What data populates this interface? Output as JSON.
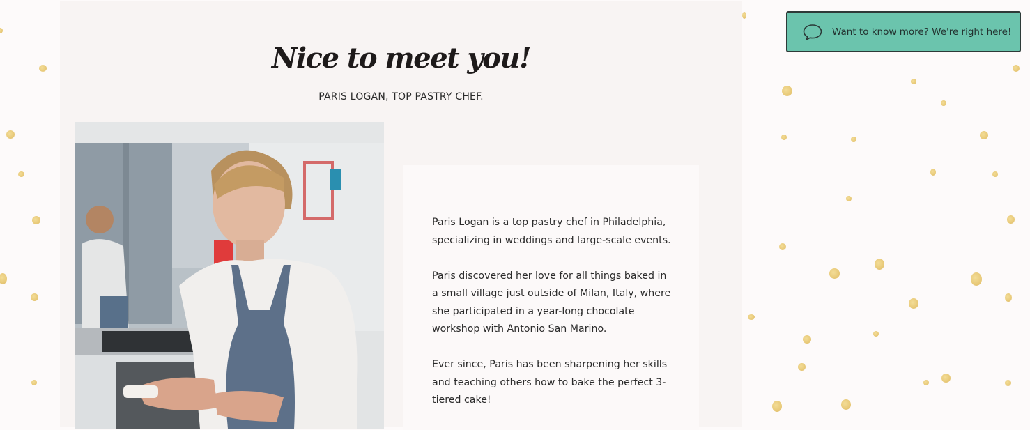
{
  "header": {
    "title": "Nice to meet you!",
    "subtitle": "PARIS LOGAN, TOP PASTRY CHEF."
  },
  "photo": {
    "alt": "Pastry chef in apron working in a kitchen"
  },
  "bio": {
    "paragraphs": [
      "Paris Logan is a top pastry chef in Philadelphia, specializing in weddings and large-scale events.",
      "Paris discovered her love for all things baked in a small village just outside of Milan, Italy, where she participated in a year-long chocolate workshop with Antonio San Marino.",
      "Ever since, Paris has been sharpening her skills and teaching others how to bake the perfect 3-tiered cake!"
    ]
  },
  "chat": {
    "label": "Want to know more? We're right here!",
    "icon": "chat-bubble-icon"
  },
  "colors": {
    "page_background": "#fdfafa",
    "panel_background": "#f8f4f3",
    "chat_background": "#6bc4ad",
    "dot_gold": "#e6c46a"
  }
}
